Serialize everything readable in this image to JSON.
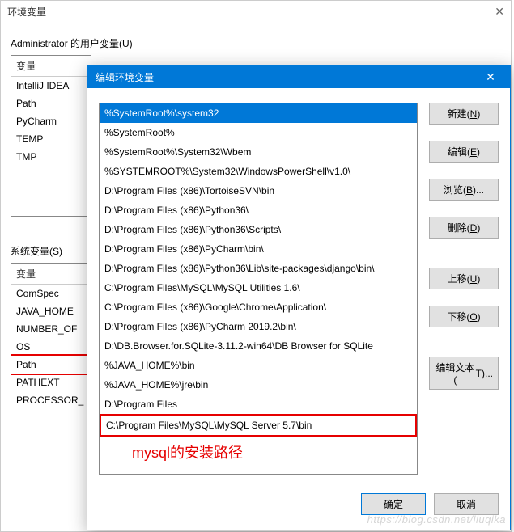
{
  "parent_dialog": {
    "title": "环境变量",
    "user_vars_label": "Administrator 的用户变量(U)",
    "sys_vars_label": "系统变量(S)",
    "column_header": "变量",
    "user_vars": [
      "IntelliJ IDEA",
      "Path",
      "PyCharm",
      "TEMP",
      "TMP"
    ],
    "sys_vars": [
      "ComSpec",
      "JAVA_HOME",
      "NUMBER_OF",
      "OS",
      "Path",
      "PATHEXT",
      "PROCESSOR_"
    ]
  },
  "edit_dialog": {
    "title": "编辑环境变量",
    "paths": [
      "%SystemRoot%\\system32",
      "%SystemRoot%",
      "%SystemRoot%\\System32\\Wbem",
      "%SYSTEMROOT%\\System32\\WindowsPowerShell\\v1.0\\",
      "D:\\Program Files (x86)\\TortoiseSVN\\bin",
      "D:\\Program Files (x86)\\Python36\\",
      "D:\\Program Files (x86)\\Python36\\Scripts\\",
      "D:\\Program Files (x86)\\PyCharm\\bin\\",
      "D:\\Program Files (x86)\\Python36\\Lib\\site-packages\\django\\bin\\",
      "C:\\Program Files\\MySQL\\MySQL Utilities 1.6\\",
      "C:\\Program Files (x86)\\Google\\Chrome\\Application\\",
      "D:\\Program Files (x86)\\PyCharm 2019.2\\bin\\",
      "D:\\DB.Browser.for.SQLite-3.11.2-win64\\DB Browser for SQLite",
      "%JAVA_HOME%\\bin",
      "%JAVA_HOME%\\jre\\bin",
      "D:\\Program Files",
      "C:\\Program Files\\MySQL\\MySQL Server 5.7\\bin"
    ],
    "buttons": {
      "new": "新建(N)",
      "edit": "编辑(E)",
      "browse": "浏览(B)...",
      "delete": "删除(D)",
      "move_up": "上移(U)",
      "move_down": "下移(O)",
      "edit_text": "编辑文本(T)...",
      "ok": "确定",
      "cancel": "取消"
    },
    "annotation": "mysql的安装路径"
  },
  "watermark": "https://blog.csdn.net/liuqika"
}
